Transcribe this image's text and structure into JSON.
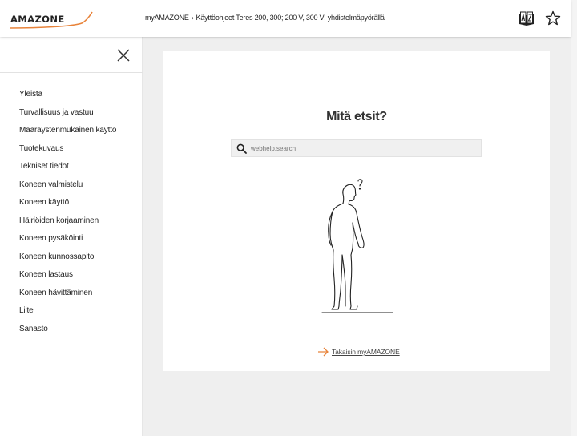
{
  "header": {
    "logo_text": "AMAZONE",
    "breadcrumb": [
      "myAMAZONE",
      "Käyttöohjeet Teres 200, 300; 200 V, 300 V; yhdistelmäpyörällä"
    ],
    "breadcrumb_separator": "›"
  },
  "sidebar": {
    "items": [
      "Yleistä",
      "Turvallisuus ja vastuu",
      "Määräystenmukainen käyttö",
      "Tuotekuvaus",
      "Tekniset tiedot",
      "Koneen valmistelu",
      "Koneen käyttö",
      "Häiriöiden korjaaminen",
      "Koneen pysäköinti",
      "Koneen kunnossapito",
      "Koneen lastaus",
      "Koneen hävittäminen",
      "Liite",
      "Sanasto"
    ]
  },
  "main": {
    "title": "Mitä etsit?",
    "search_placeholder": "webhelp.search",
    "back_link": "Takaisin myAMAZONE"
  },
  "colors": {
    "accent": "#e8833a",
    "text": "#222222",
    "background": "#efefef"
  }
}
